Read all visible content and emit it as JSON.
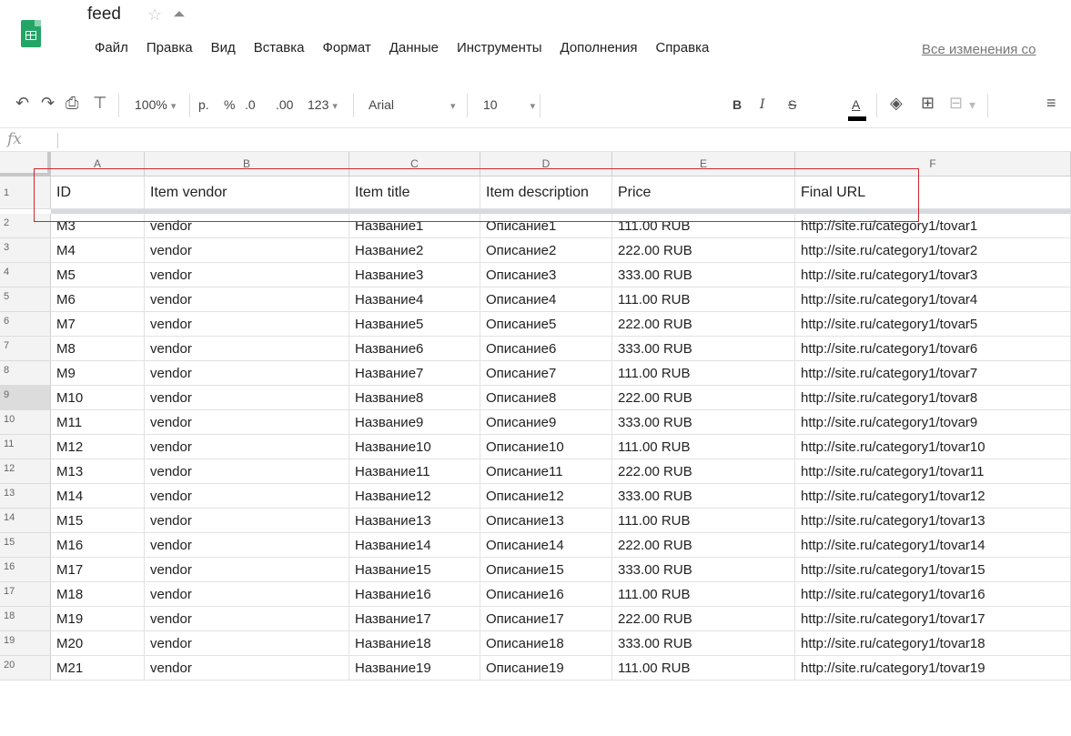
{
  "app": {
    "doc_title": "feed",
    "menu": [
      "Файл",
      "Правка",
      "Вид",
      "Вставка",
      "Формат",
      "Данные",
      "Инструменты",
      "Дополнения",
      "Справка"
    ],
    "autosave_text": "Все изменения со"
  },
  "toolbar": {
    "zoom": "100%",
    "currency": "р.",
    "percent": "%",
    "decrease_decimal": ".0",
    "increase_decimal": ".00",
    "more_formats": "123",
    "font": "Arial",
    "font_size": "10",
    "bold": "B",
    "italic": "I",
    "strikethrough": "S",
    "text_color": "A"
  },
  "formula_bar": {
    "label": "fx",
    "value": ""
  },
  "columns": [
    "A",
    "B",
    "C",
    "D",
    "E",
    "F"
  ],
  "header_row": {
    "row_number": "1",
    "cells": [
      "ID",
      "Item vendor",
      "Item title",
      "Item description",
      "Price",
      "Final URL"
    ]
  },
  "rows": [
    {
      "n": "2",
      "cells": [
        "M3",
        "vendor",
        "Название1",
        "Описание1",
        "111.00 RUB",
        "http://site.ru/category1/tovar1"
      ]
    },
    {
      "n": "3",
      "cells": [
        "M4",
        "vendor",
        "Название2",
        "Описание2",
        "222.00 RUB",
        "http://site.ru/category1/tovar2"
      ]
    },
    {
      "n": "4",
      "cells": [
        "M5",
        "vendor",
        "Название3",
        "Описание3",
        "333.00 RUB",
        "http://site.ru/category1/tovar3"
      ]
    },
    {
      "n": "5",
      "cells": [
        "M6",
        "vendor",
        "Название4",
        "Описание4",
        "111.00 RUB",
        "http://site.ru/category1/tovar4"
      ]
    },
    {
      "n": "6",
      "cells": [
        "M7",
        "vendor",
        "Название5",
        "Описание5",
        "222.00 RUB",
        "http://site.ru/category1/tovar5"
      ]
    },
    {
      "n": "7",
      "cells": [
        "M8",
        "vendor",
        "Название6",
        "Описание6",
        "333.00 RUB",
        "http://site.ru/category1/tovar6"
      ]
    },
    {
      "n": "8",
      "cells": [
        "M9",
        "vendor",
        "Название7",
        "Описание7",
        "111.00 RUB",
        "http://site.ru/category1/tovar7"
      ]
    },
    {
      "n": "9",
      "cells": [
        "M10",
        "vendor",
        "Название8",
        "Описание8",
        "222.00 RUB",
        "http://site.ru/category1/tovar8"
      ]
    },
    {
      "n": "10",
      "cells": [
        "M11",
        "vendor",
        "Название9",
        "Описание9",
        "333.00 RUB",
        "http://site.ru/category1/tovar9"
      ]
    },
    {
      "n": "11",
      "cells": [
        "M12",
        "vendor",
        "Название10",
        "Описание10",
        "111.00 RUB",
        "http://site.ru/category1/tovar10"
      ]
    },
    {
      "n": "12",
      "cells": [
        "M13",
        "vendor",
        "Название11",
        "Описание11",
        "222.00 RUB",
        "http://site.ru/category1/tovar11"
      ]
    },
    {
      "n": "13",
      "cells": [
        "M14",
        "vendor",
        "Название12",
        "Описание12",
        "333.00 RUB",
        "http://site.ru/category1/tovar12"
      ]
    },
    {
      "n": "14",
      "cells": [
        "M15",
        "vendor",
        "Название13",
        "Описание13",
        "111.00 RUB",
        "http://site.ru/category1/tovar13"
      ]
    },
    {
      "n": "15",
      "cells": [
        "M16",
        "vendor",
        "Название14",
        "Описание14",
        "222.00 RUB",
        "http://site.ru/category1/tovar14"
      ]
    },
    {
      "n": "16",
      "cells": [
        "M17",
        "vendor",
        "Название15",
        "Описание15",
        "333.00 RUB",
        "http://site.ru/category1/tovar15"
      ]
    },
    {
      "n": "17",
      "cells": [
        "M18",
        "vendor",
        "Название16",
        "Описание16",
        "111.00 RUB",
        "http://site.ru/category1/tovar16"
      ]
    },
    {
      "n": "18",
      "cells": [
        "M19",
        "vendor",
        "Название17",
        "Описание17",
        "222.00 RUB",
        "http://site.ru/category1/tovar17"
      ]
    },
    {
      "n": "19",
      "cells": [
        "M20",
        "vendor",
        "Название18",
        "Описание18",
        "333.00 RUB",
        "http://site.ru/category1/tovar18"
      ]
    },
    {
      "n": "20",
      "cells": [
        "M21",
        "vendor",
        "Название19",
        "Описание19",
        "111.00 RUB",
        "http://site.ru/category1/tovar19"
      ]
    }
  ],
  "selected_row": "9",
  "colors": {
    "highlight_box": "#d0262c",
    "sheets_green": "#23a566"
  }
}
